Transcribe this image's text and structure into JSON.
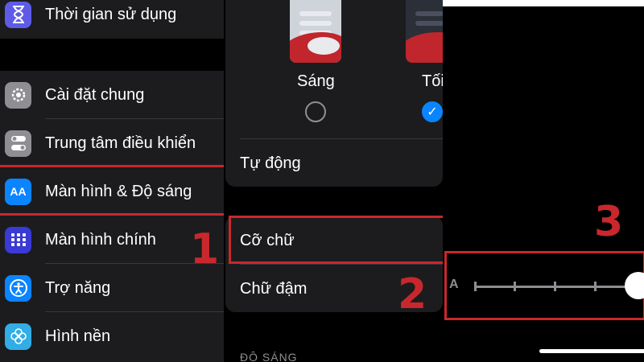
{
  "settings_list": {
    "items": [
      {
        "label": "Thời gian sử dụng",
        "icon": "hourglass-icon",
        "color": "#5e5ce6"
      },
      {
        "label": "Cài đặt chung",
        "icon": "gear-icon",
        "color": "#8e8e93"
      },
      {
        "label": "Trung tâm điều khiển",
        "icon": "toggles-icon",
        "color": "#8e8e93"
      },
      {
        "label": "Màn hình & Độ sáng",
        "icon": "text-size-icon",
        "color": "#0a84ff"
      },
      {
        "label": "Màn hình chính",
        "icon": "app-grid-icon",
        "color": "#3a3ad6"
      },
      {
        "label": "Trợ năng",
        "icon": "accessibility-icon",
        "color": "#0a84ff"
      },
      {
        "label": "Hình nền",
        "icon": "flower-icon",
        "color": "#32ade6"
      }
    ]
  },
  "display": {
    "appearance": {
      "light_label": "Sáng",
      "dark_label": "Tối",
      "selected": "dark"
    },
    "automatic_label": "Tự động",
    "text_size_label": "Cỡ chữ",
    "bold_text_label": "Chữ đậm",
    "brightness_header": "ĐỘ SÁNG"
  },
  "text_size": {
    "small_a": "A",
    "level": 7,
    "max_level": 7
  },
  "steps": [
    "1",
    "2",
    "3"
  ],
  "colors": {
    "highlight": "#c8282d",
    "accent": "#0a84ff"
  }
}
